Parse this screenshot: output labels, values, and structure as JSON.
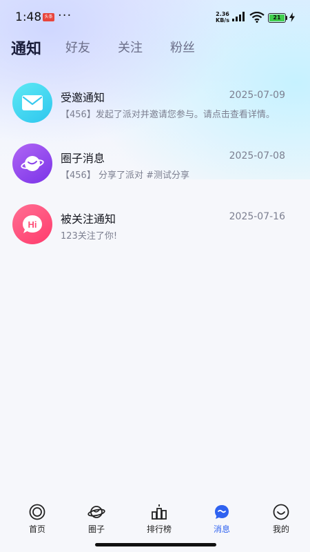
{
  "status_bar": {
    "time": "1:48",
    "badge": "头条",
    "dots": "···",
    "net_speed_value": "2.36",
    "net_speed_unit": "KB/s",
    "battery": "21"
  },
  "tabs": [
    {
      "label": "通知",
      "active": true
    },
    {
      "label": "好友",
      "active": false
    },
    {
      "label": "关注",
      "active": false
    },
    {
      "label": "粉丝",
      "active": false
    }
  ],
  "notifications": [
    {
      "icon": "mail-icon",
      "title": "受邀通知",
      "date": "2025-07-09",
      "preview": "【456】发起了派对并邀请您参与。请点击查看详情。"
    },
    {
      "icon": "circle-planet-icon",
      "title": "圈子消息",
      "date": "2025-07-08",
      "preview": "【456】 分享了派对 #测试分享"
    },
    {
      "icon": "hi-bubble-icon",
      "title": "被关注通知",
      "date": "2025-07-16",
      "preview": "123关注了你!"
    }
  ],
  "bottom_nav": [
    {
      "label": "首页",
      "icon": "home-icon",
      "active": false
    },
    {
      "label": "圈子",
      "icon": "planet-icon",
      "active": false
    },
    {
      "label": "排行榜",
      "icon": "ranking-icon",
      "active": false
    },
    {
      "label": "消息",
      "icon": "message-icon",
      "active": true
    },
    {
      "label": "我的",
      "icon": "profile-icon",
      "active": false
    }
  ],
  "colors": {
    "accent": "#2f62f0",
    "mail_avatar": "#2ec6ee",
    "circle_avatar": "#7a33e8",
    "hi_avatar": "#ff3b6c"
  }
}
